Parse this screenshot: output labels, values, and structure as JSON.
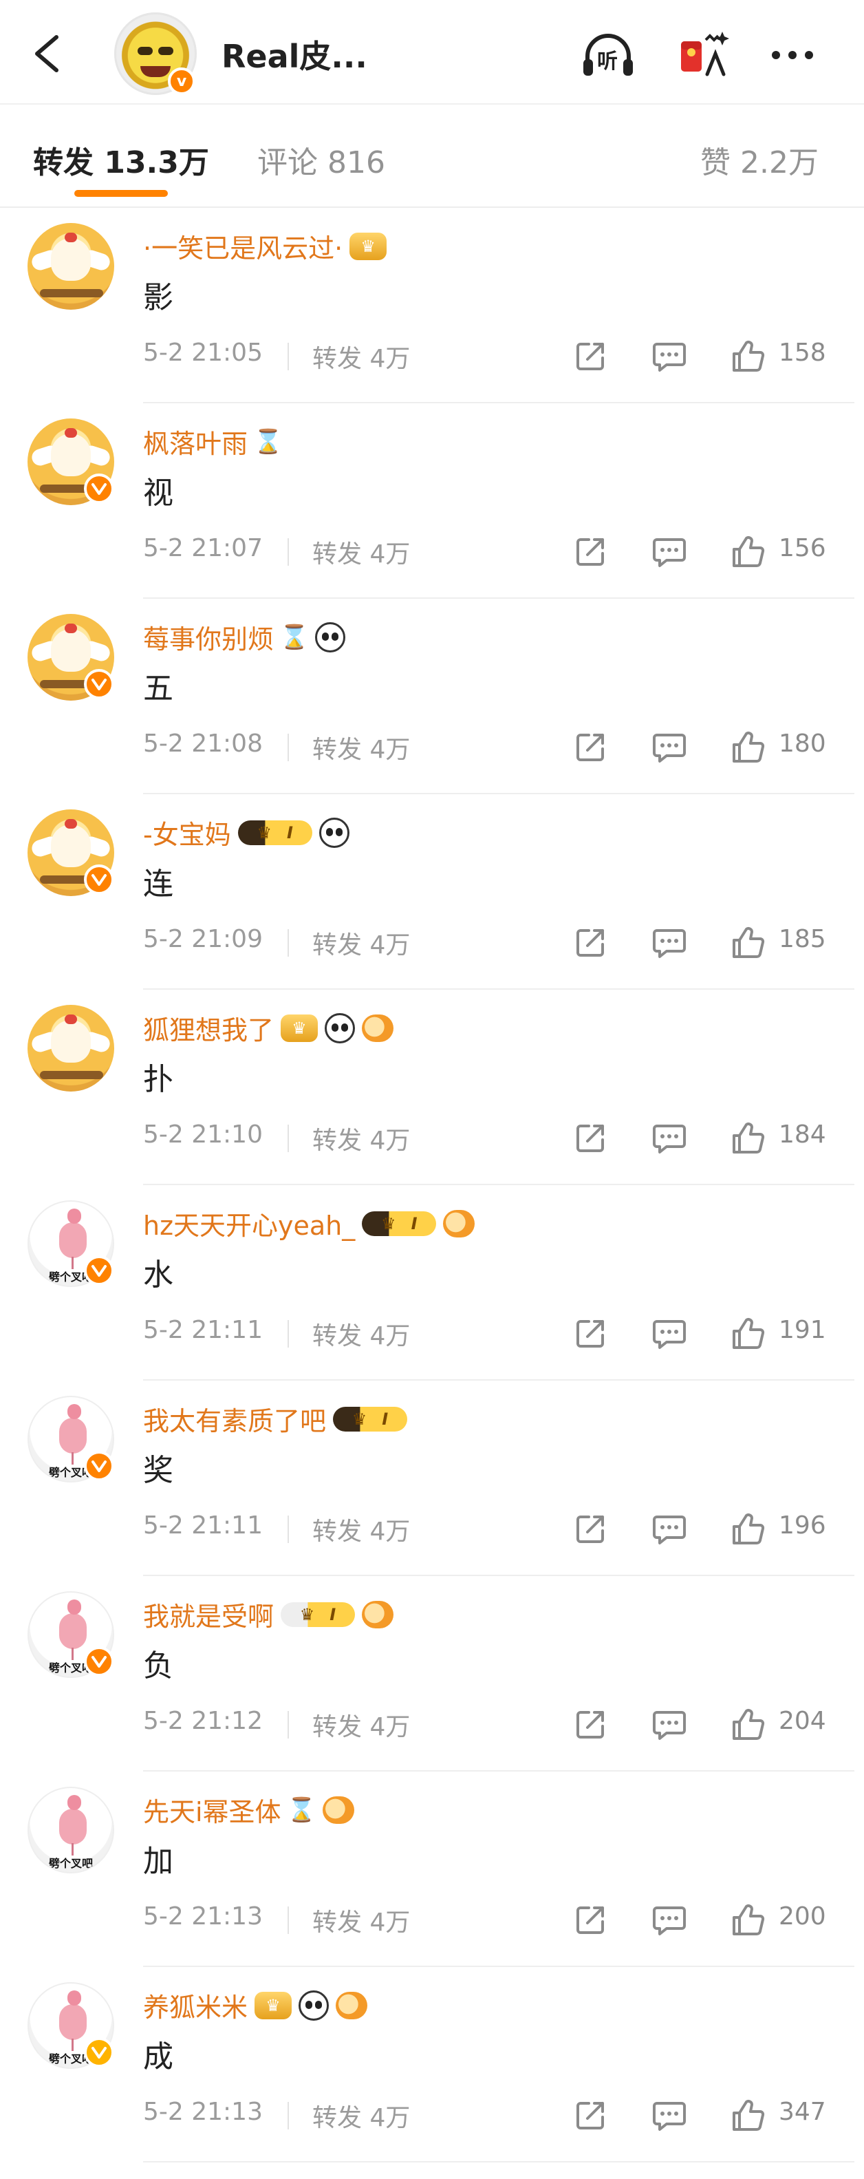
{
  "header": {
    "title": "Real皮...",
    "avatar_badge": "v",
    "listen_label": "听",
    "icons": [
      "back-icon",
      "listen-headphones-icon",
      "red-packet-icon",
      "more-icon"
    ]
  },
  "tabs": {
    "repost_label": "转发",
    "repost_count": "13.3万",
    "comment_label": "评论",
    "comment_count": "816",
    "like_label": "赞",
    "like_count": "2.2万",
    "accent": "#ff8200"
  },
  "colors": {
    "username": "#e1771b",
    "meta": "#9b9b9b",
    "verified": "#ff8200"
  },
  "reposts": [
    {
      "user": "·一笑已是风云过·",
      "text": "影",
      "time": "5-2 21:05",
      "repost": "转发 4万",
      "likes": "158",
      "avatar": "chick",
      "verified": false,
      "badges": [
        "crown-icon"
      ]
    },
    {
      "user": "枫落叶雨",
      "text": "视",
      "time": "5-2 21:07",
      "repost": "转发 4万",
      "likes": "156",
      "avatar": "chick",
      "verified": true,
      "badges": [
        "hourglass-icon"
      ]
    },
    {
      "user": "莓事你别烦",
      "text": "五",
      "time": "5-2 21:08",
      "repost": "转发 4万",
      "likes": "180",
      "avatar": "chick",
      "verified": true,
      "badges": [
        "hourglass-icon",
        "panda-icon"
      ]
    },
    {
      "user": "-女宝妈",
      "text": "连",
      "time": "5-2 21:09",
      "repost": "转发 4万",
      "likes": "185",
      "avatar": "chick",
      "verified": true,
      "badges": [
        "crown-level-icon",
        "panda-icon"
      ]
    },
    {
      "user": "狐狸想我了",
      "text": "扑",
      "time": "5-2 21:10",
      "repost": "转发 4万",
      "likes": "184",
      "avatar": "chick",
      "verified": false,
      "badges": [
        "crown-icon",
        "panda-icon",
        "fish-icon"
      ]
    },
    {
      "user": "hz天天开心yeah_",
      "text": "水",
      "time": "5-2 21:11",
      "repost": "转发 4万",
      "likes": "191",
      "avatar": "flamingo",
      "verified": true,
      "badges": [
        "crown-level-icon",
        "fish-icon"
      ]
    },
    {
      "user": "我太有素质了吧",
      "text": "奖",
      "time": "5-2 21:11",
      "repost": "转发 4万",
      "likes": "196",
      "avatar": "flamingo",
      "verified": true,
      "badges": [
        "crown-level-icon"
      ]
    },
    {
      "user": "我就是受啊",
      "text": "负",
      "time": "5-2 21:12",
      "repost": "转发 4万",
      "likes": "204",
      "avatar": "flamingo",
      "verified": true,
      "badges": [
        "crown-level-light-icon",
        "fish-icon"
      ]
    },
    {
      "user": "先天i幂圣体",
      "text": "加",
      "time": "5-2 21:13",
      "repost": "转发 4万",
      "likes": "200",
      "avatar": "flamingo",
      "verified": false,
      "badges": [
        "hourglass-icon",
        "fish-icon"
      ]
    },
    {
      "user": "养狐米米",
      "text": "成",
      "time": "5-2 21:13",
      "repost": "转发 4万",
      "likes": "347",
      "avatar": "flamingo",
      "verified": true,
      "verified_color": "#ffb300",
      "badges": [
        "crown-icon",
        "panda-icon",
        "fish-icon"
      ]
    }
  ],
  "avatar_captions": {
    "flamingo": "劈个叉吧"
  },
  "level_badge_text": "I"
}
